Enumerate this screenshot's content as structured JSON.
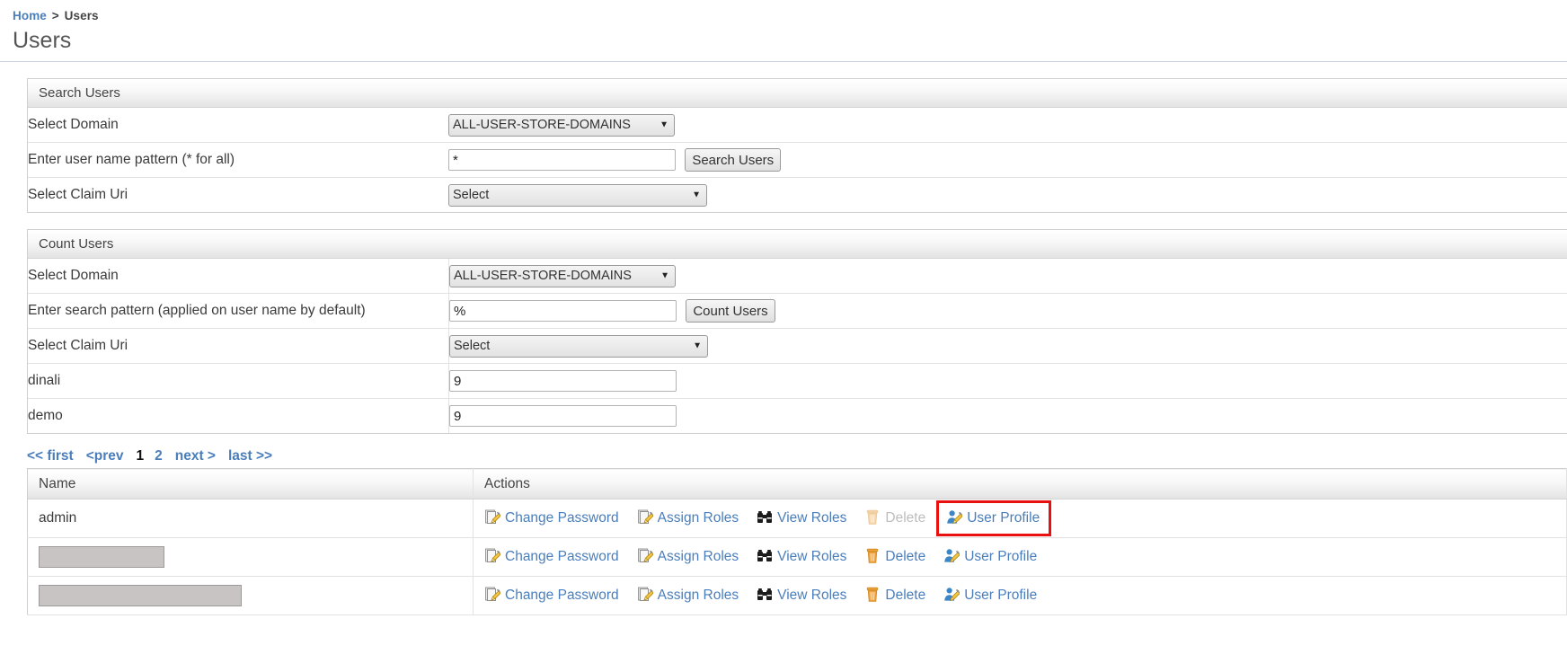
{
  "breadcrumb": {
    "home": "Home",
    "separator": ">",
    "current": "Users"
  },
  "page_title": "Users",
  "search_panel": {
    "title": "Search Users",
    "rows": [
      {
        "label": "Select Domain",
        "value": "ALL-USER-STORE-DOMAINS"
      },
      {
        "label": "Enter user name pattern (* for all)",
        "value": "*",
        "button": "Search Users"
      },
      {
        "label": "Select Claim Uri",
        "value": "Select"
      }
    ]
  },
  "count_panel": {
    "title": "Count Users",
    "rows": [
      {
        "label": "Select Domain",
        "value": "ALL-USER-STORE-DOMAINS"
      },
      {
        "label": "Enter search pattern (applied on user name by default)",
        "value": "%",
        "button": "Count Users"
      },
      {
        "label": "Select Claim Uri",
        "value": "Select"
      },
      {
        "label": "dinali",
        "value": "9"
      },
      {
        "label": "demo",
        "value": "9"
      }
    ]
  },
  "pagination": {
    "first": "<< first",
    "prev": "<prev",
    "pages": [
      "1",
      "2"
    ],
    "current_page": "1",
    "next": "next >",
    "last": "last >>"
  },
  "users_table": {
    "headers": {
      "name": "Name",
      "actions": "Actions"
    },
    "rows": [
      {
        "name": "admin",
        "redacted": false,
        "redacted_width": 0,
        "actions": [
          {
            "label": "Change Password",
            "icon": "page-pencil-icon",
            "disabled": false,
            "highlighted": false
          },
          {
            "label": "Assign Roles",
            "icon": "page-pencil-icon",
            "disabled": false,
            "highlighted": false
          },
          {
            "label": "View Roles",
            "icon": "binoculars-icon",
            "disabled": false,
            "highlighted": false
          },
          {
            "label": "Delete",
            "icon": "trash-icon",
            "disabled": true,
            "highlighted": false
          },
          {
            "label": "User Profile",
            "icon": "user-pencil-icon",
            "disabled": false,
            "highlighted": true
          }
        ]
      },
      {
        "name": "",
        "redacted": true,
        "redacted_width": 138,
        "actions": [
          {
            "label": "Change Password",
            "icon": "page-pencil-icon",
            "disabled": false,
            "highlighted": false
          },
          {
            "label": "Assign Roles",
            "icon": "page-pencil-icon",
            "disabled": false,
            "highlighted": false
          },
          {
            "label": "View Roles",
            "icon": "binoculars-icon",
            "disabled": false,
            "highlighted": false
          },
          {
            "label": "Delete",
            "icon": "trash-icon",
            "disabled": false,
            "highlighted": false
          },
          {
            "label": "User Profile",
            "icon": "user-pencil-icon",
            "disabled": false,
            "highlighted": false
          }
        ]
      },
      {
        "name": "",
        "redacted": true,
        "redacted_width": 224,
        "actions": [
          {
            "label": "Change Password",
            "icon": "page-pencil-icon",
            "disabled": false,
            "highlighted": false
          },
          {
            "label": "Assign Roles",
            "icon": "page-pencil-icon",
            "disabled": false,
            "highlighted": false
          },
          {
            "label": "View Roles",
            "icon": "binoculars-icon",
            "disabled": false,
            "highlighted": false
          },
          {
            "label": "Delete",
            "icon": "trash-icon",
            "disabled": false,
            "highlighted": false
          },
          {
            "label": "User Profile",
            "icon": "user-pencil-icon",
            "disabled": false,
            "highlighted": false
          }
        ]
      }
    ]
  },
  "colors": {
    "link": "#4a7ebb",
    "highlight_box": "#e8110f",
    "panel_border": "#cfcfcf",
    "redaction": "#c8c4c4",
    "trash": "#efa03a",
    "pencil": "#f2c744"
  }
}
